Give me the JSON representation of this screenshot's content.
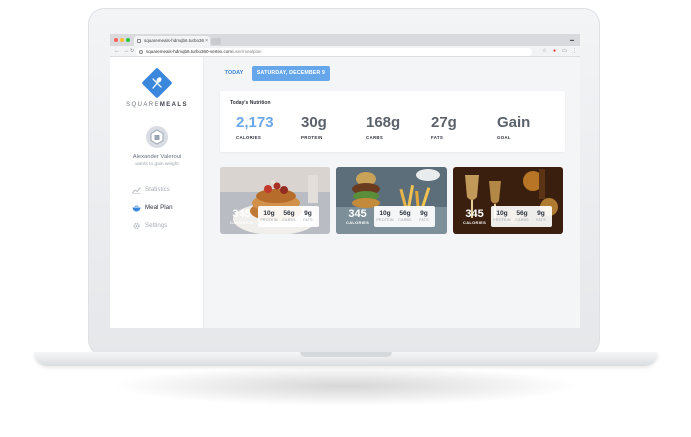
{
  "browser": {
    "tab_title": "squaremeals-hdmqb6.turbo36",
    "url_host": "squaremeals-hdmqb6.turbo360-vertex.com",
    "url_path": "/user/mealplan",
    "close_glyph": "×"
  },
  "sidebar": {
    "brand_light": "SQUARE",
    "brand_bold": "MEALS",
    "user_name": "Alexander Valeroui",
    "user_goal": "wants to gain weight",
    "menu": [
      {
        "label": "Statistics",
        "icon": "chart-icon",
        "active": false
      },
      {
        "label": "Meal Plan",
        "icon": "bowl-icon",
        "active": true
      },
      {
        "label": "Settings",
        "icon": "gear-icon",
        "active": false
      }
    ]
  },
  "header": {
    "today_label": "TODAY",
    "date_label": "SATURDAY, DECEMBER 9"
  },
  "nutrition": {
    "title": "Today's Nutrition",
    "stats": [
      {
        "value": "2,173",
        "label": "CALORIES",
        "highlight": true
      },
      {
        "value": "30g",
        "label": "PROTEIN",
        "highlight": false
      },
      {
        "value": "168g",
        "label": "CARBS",
        "highlight": false
      },
      {
        "value": "27g",
        "label": "FATS",
        "highlight": false
      },
      {
        "value": "Gain",
        "label": "GOAL",
        "highlight": false
      }
    ]
  },
  "meals": [
    {
      "calories": "345",
      "calories_label": "CALORIES",
      "protein": "10g",
      "protein_label": "PROTEIN",
      "carbs": "56g",
      "carbs_label": "CARBS",
      "fats": "9g",
      "fats_label": "FATS",
      "photo": "pancakes"
    },
    {
      "calories": "345",
      "calories_label": "CALORIES",
      "protein": "10g",
      "protein_label": "PROTEIN",
      "carbs": "56g",
      "carbs_label": "CARBS",
      "fats": "9g",
      "fats_label": "FATS",
      "photo": "burger-and-fries"
    },
    {
      "calories": "345",
      "calories_label": "CALORIES",
      "protein": "10g",
      "protein_label": "PROTEIN",
      "carbs": "56g",
      "carbs_label": "CARBS",
      "fats": "9g",
      "fats_label": "FATS",
      "photo": "wine-glasses"
    }
  ],
  "colors": {
    "accent": "#3b87dc",
    "date_button": "#66a7ec",
    "calories_value": "#6ca7e8"
  }
}
